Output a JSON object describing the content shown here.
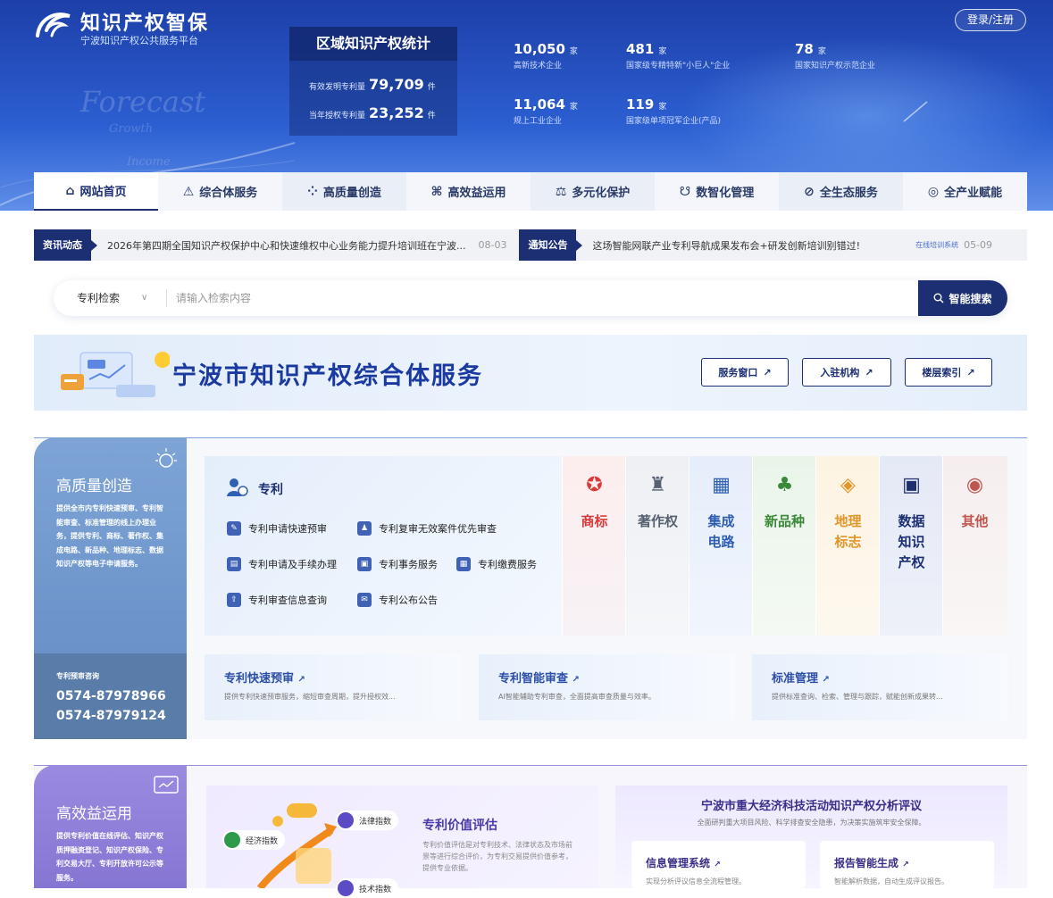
{
  "header": {
    "brand": "知识产权智保",
    "brand_sub": "宁波知识产权公共服务平台",
    "login": "登录/注册",
    "watermark": [
      "Forecast",
      "Growth",
      "Income"
    ]
  },
  "stats": {
    "title": "区域知识产权统计",
    "rows": [
      {
        "label": "有效发明专利量",
        "value": "79,709",
        "unit": "件"
      },
      {
        "label": "当年授权专利量",
        "value": "23,252",
        "unit": "件"
      }
    ],
    "numbers": [
      {
        "value": "10,050",
        "unit": "家",
        "desc": "高新技术企业"
      },
      {
        "value": "481",
        "unit": "家",
        "desc": "国家级专精特新\"小巨人\"企业"
      },
      {
        "value": "78",
        "unit": "家",
        "desc": "国家知识产权示范企业"
      },
      {
        "value": "11,064",
        "unit": "家",
        "desc": "规上工业企业"
      },
      {
        "value": "119",
        "unit": "家",
        "desc": "国家级单项冠军企业(产品)"
      }
    ]
  },
  "nav": {
    "items": [
      {
        "label": "网站首页",
        "icon": "⌂"
      },
      {
        "label": "综合体服务",
        "icon": "⚠"
      },
      {
        "label": "高质量创造",
        "icon": "⁘"
      },
      {
        "label": "高效益运用",
        "icon": "⌘"
      },
      {
        "label": "多元化保护",
        "icon": "⚖"
      },
      {
        "label": "数智化管理",
        "icon": "☋"
      },
      {
        "label": "全生态服务",
        "icon": "⊘"
      },
      {
        "label": "全产业赋能",
        "icon": "◎"
      }
    ]
  },
  "news": {
    "tag1": "资讯动态",
    "text1": "2026年第四期全国知识产权保护中心和快速维权中心业务能力提升培训班在宁波...",
    "date1": "08-03",
    "tag2": "通知公告",
    "text2": "这场智能网联产业专利导航成果发布会+研发创新培训别错过!",
    "source2": "在线培训系统",
    "date2": "05-09"
  },
  "search": {
    "type": "专利检索",
    "placeholder": "请输入检索内容",
    "button": "智能搜索"
  },
  "banner": {
    "title": "宁波市知识产权综合体服务",
    "buttons": [
      "服务窗口",
      "入驻机构",
      "楼层索引"
    ]
  },
  "section1": {
    "title": "高质量创造",
    "desc": "提供全市内专利快速预审、专利智能审查、标准管理的线上办理业务，提供专利、商标、著作权、集成电路、新品种、地理标志、数据知识产权等电子申请服务。",
    "hotline_label": "专利预审咨询",
    "hotlines": [
      "0574-87978966",
      "0574-87979124"
    ],
    "patent_title": "专利",
    "patent_links": [
      "专利申请快速预审",
      "专利复审无效案件优先审查",
      "专利申请及手续办理",
      "专利事务服务",
      "专利缴费服务",
      "专利审查信息查询",
      "专利公布公告"
    ],
    "categories": [
      {
        "label": "商标",
        "color": "#d83a3a",
        "icon": "✪"
      },
      {
        "label": "著作权",
        "color": "#556070",
        "icon": "♜"
      },
      {
        "label": "集成电路",
        "color": "#2f5fb3",
        "icon": "▦"
      },
      {
        "label": "新品种",
        "color": "#3a8a3a",
        "icon": "♣"
      },
      {
        "label": "地理标志",
        "color": "#e0962a",
        "icon": "◈"
      },
      {
        "label": "数据知识产权",
        "color": "#1c2f73",
        "icon": "▣"
      },
      {
        "label": "其他",
        "color": "#c0574e",
        "icon": "◉"
      }
    ],
    "cards": [
      {
        "title": "专利快速预审",
        "desc": "提供专利快速预审服务，缩短审查周期，提升授权效..."
      },
      {
        "title": "专利智能审查",
        "desc": "AI智能辅助专利审查，全面提高审查质量与效率。"
      },
      {
        "title": "标准管理",
        "desc": "提供标准查询、检索、管理与跟踪，赋能创新成果转..."
      }
    ]
  },
  "section2": {
    "title": "高效益运用",
    "desc": "提供专利价值在线评估、知识产权质押融资登记、知识产权保险、专利交易大厅、专利开放许可公示等服务。",
    "valuation_title": "专利价值评估",
    "valuation_desc": "专利价值评估是对专利技术、法律状态及市场前景等进行综合评价，为专利交易提供价值参考，提供专业依据。",
    "tags": [
      "法律指数",
      "经济指数",
      "技术指数"
    ],
    "analysis_title": "宁波市重大经济科技活动知识产权分析评议",
    "analysis_sub": "全面研判重大项目风险、科学排查安全隐患，为决策实施筑牢安全保障。",
    "sub_cards": [
      {
        "title": "信息管理系统",
        "desc": "实现分析评议信息全流程管理。"
      },
      {
        "title": "报告智能生成",
        "desc": "智能解析数据，自动生成评议报告。"
      }
    ]
  }
}
